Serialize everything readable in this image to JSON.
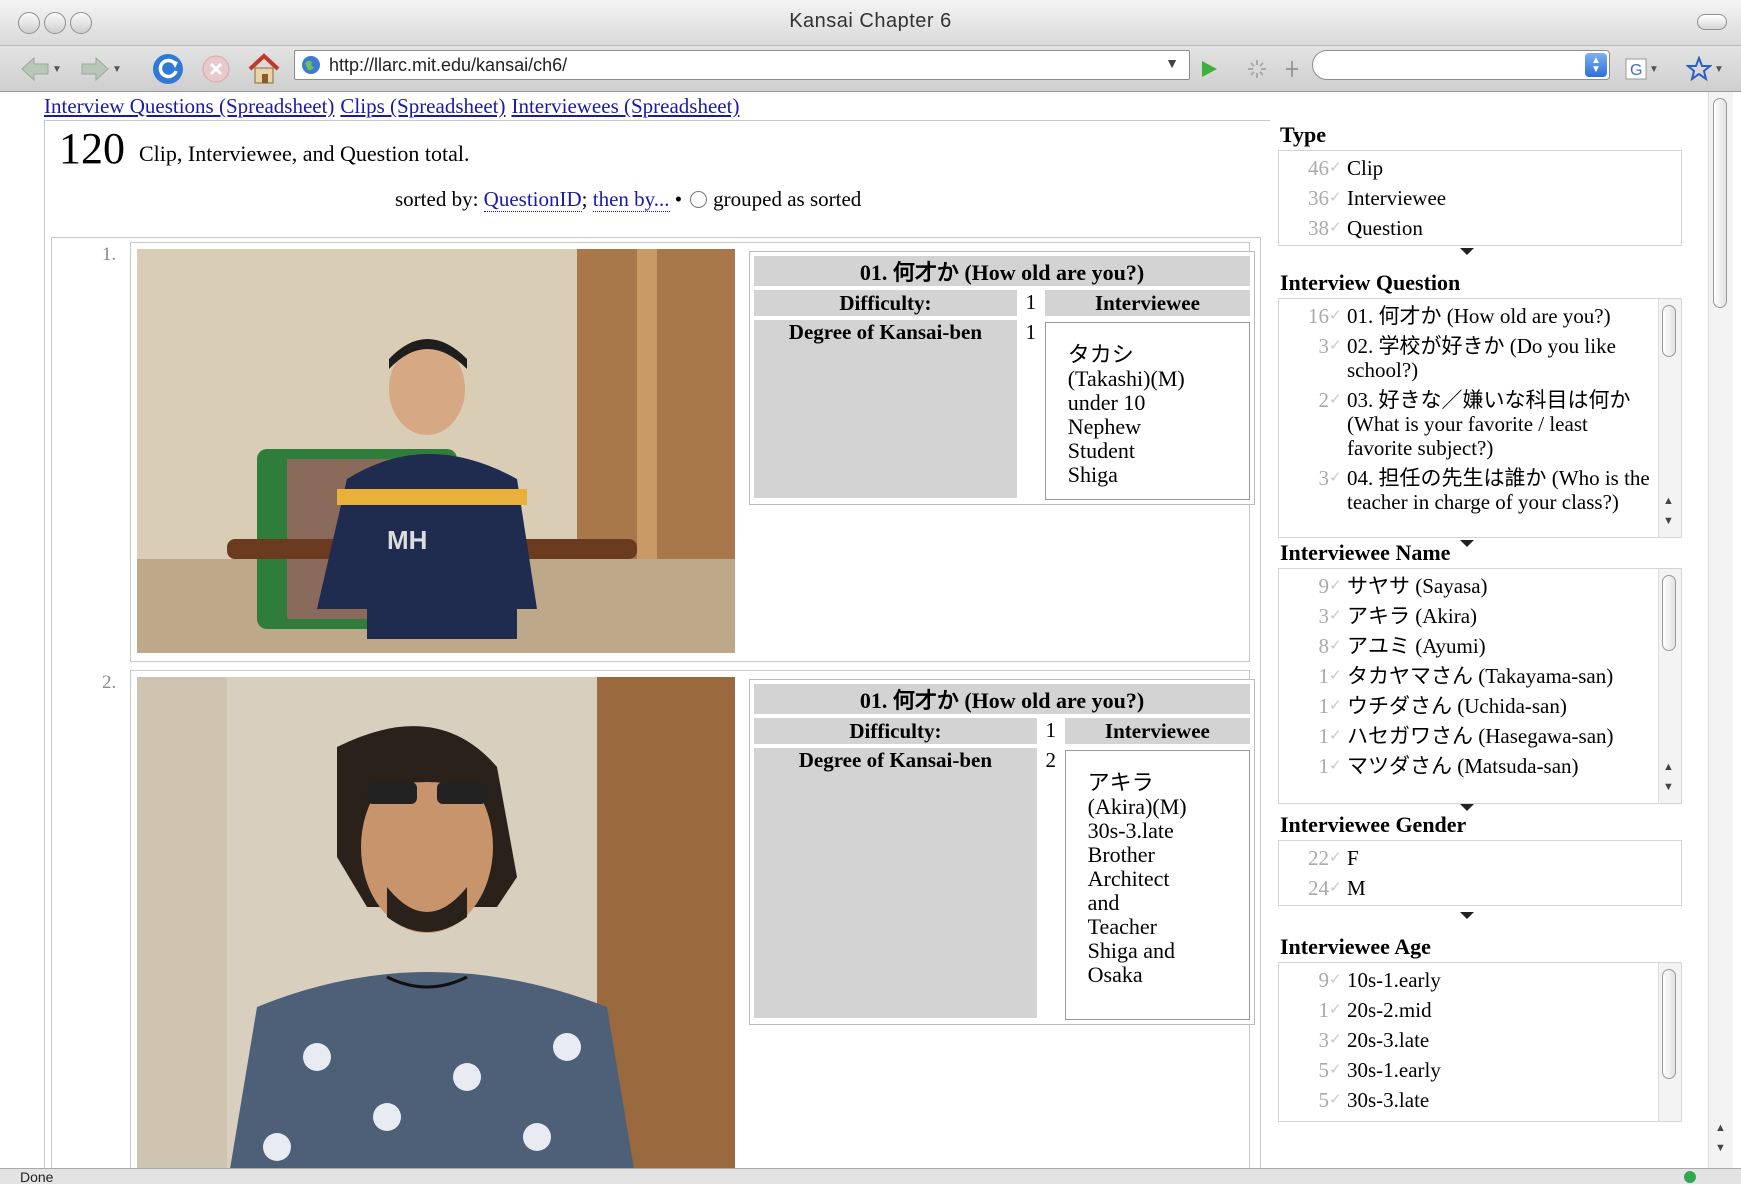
{
  "window": {
    "title": "Kansai Chapter 6"
  },
  "toolbar": {
    "url": "http://llarc.mit.edu/kansai/ch6/"
  },
  "top_links": [
    "Interview Questions (Spreadsheet)",
    "Clips (Spreadsheet)",
    "Interviewees (Spreadsheet)"
  ],
  "summary": {
    "count": "120",
    "label": "Clip, Interviewee, and Question total."
  },
  "sort": {
    "prefix": "sorted by: ",
    "field": "QuestionID",
    "then": "then by...",
    "grouped": "grouped as sorted"
  },
  "items": [
    {
      "num": "1.",
      "question": "01. 何才か (How old are you?)",
      "difficulty_label": "Difficulty:",
      "difficulty": "1",
      "interviewee_label": "Interviewee",
      "kansai_label": "Degree of Kansai-ben",
      "kansai": "1",
      "interviewee": [
        "タカシ",
        "(Takashi)(M)",
        "under 10",
        "Nephew",
        "Student",
        "Shiga"
      ]
    },
    {
      "num": "2.",
      "question": "01. 何才か (How old are you?)",
      "difficulty_label": "Difficulty:",
      "difficulty": "1",
      "interviewee_label": "Interviewee",
      "kansai_label": "Degree of Kansai-ben",
      "kansai": "2",
      "interviewee": [
        "アキラ",
        "(Akira)(M)",
        "30s-3.late",
        "Brother",
        "Architect",
        "and",
        "Teacher",
        "Shiga and",
        "Osaka"
      ]
    }
  ],
  "facets": {
    "type": {
      "title": "Type",
      "rows": [
        {
          "count": "46",
          "label": "Clip"
        },
        {
          "count": "36",
          "label": "Interviewee"
        },
        {
          "count": "38",
          "label": "Question"
        }
      ]
    },
    "question": {
      "title": "Interview Question",
      "rows": [
        {
          "count": "16",
          "label": "01. 何才か (How old are you?)"
        },
        {
          "count": "3",
          "label": "02. 学校が好きか (Do you like school?)"
        },
        {
          "count": "2",
          "label": "03. 好きな／嫌いな科目は何か (What is your favorite / least favorite subject?)"
        },
        {
          "count": "3",
          "label": "04. 担任の先生は誰か (Who is the teacher in charge of your class?)"
        }
      ]
    },
    "name": {
      "title": "Interviewee Name",
      "rows": [
        {
          "count": "9",
          "label": "サヤサ (Sayasa)"
        },
        {
          "count": "3",
          "label": "アキラ (Akira)"
        },
        {
          "count": "8",
          "label": "アユミ (Ayumi)"
        },
        {
          "count": "1",
          "label": "タカヤマさん (Takayama-san)"
        },
        {
          "count": "1",
          "label": "ウチダさん (Uchida-san)"
        },
        {
          "count": "1",
          "label": "ハセガワさん (Hasegawa-san)"
        },
        {
          "count": "1",
          "label": "マツダさん (Matsuda-san)"
        }
      ]
    },
    "gender": {
      "title": "Interviewee Gender",
      "rows": [
        {
          "count": "22",
          "label": "F"
        },
        {
          "count": "24",
          "label": "M"
        }
      ]
    },
    "age": {
      "title": "Interviewee Age",
      "rows": [
        {
          "count": "9",
          "label": "10s-1.early"
        },
        {
          "count": "1",
          "label": "20s-2.mid"
        },
        {
          "count": "3",
          "label": "20s-3.late"
        },
        {
          "count": "5",
          "label": "30s-1.early"
        },
        {
          "count": "5",
          "label": "30s-3.late"
        }
      ]
    }
  },
  "status": {
    "text": "Done"
  },
  "icons": {
    "back": "back-arrow-icon",
    "forward": "forward-arrow-icon",
    "reload": "reload-icon",
    "stop": "stop-icon",
    "home": "home-icon",
    "go": "go-arrow-icon",
    "search_engine": "google-icon",
    "bookmark": "star-icon"
  }
}
